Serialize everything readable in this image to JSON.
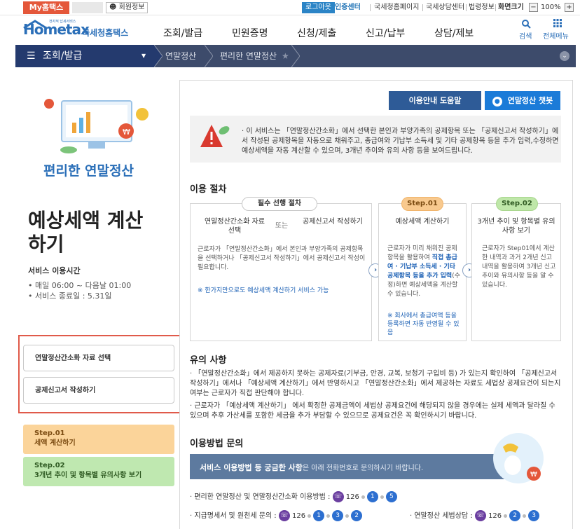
{
  "topbar": {
    "my_hometax": "My홈택스",
    "member_info": "회원정보",
    "logout": "로그아웃",
    "auth_center": "인증센터",
    "nts_home": "국세청홈페이지",
    "tax_counsel": "국세상담센터",
    "law_info": "법령정보",
    "screen_size": "화면크기",
    "zoom_minus": "−",
    "zoom_value": "100%",
    "zoom_plus": "+"
  },
  "header": {
    "logo_text": "Hometax",
    "logo_sub": "전자적 납세서비스",
    "logo_kr": "국세청홈택스",
    "gnb": [
      "조회/발급",
      "민원증명",
      "신청/제출",
      "신고/납부",
      "상담/제보"
    ],
    "search_label": "검색",
    "allmenu_label": "전체메뉴"
  },
  "breadcrumb": {
    "main": "조회/발급",
    "items": [
      "연말정산",
      "편리한 연말정산"
    ],
    "star": "★"
  },
  "left": {
    "service_title": "편리한 연말정산",
    "page_title": "예상세액 계산하기",
    "hours_heading": "서비스 이용시간",
    "hours_items": [
      "• 매일 06:00 ~ 다음날 01:00",
      "• 서비스 종료일 : 5.31일"
    ],
    "btn_simplified": "연말정산간소화 자료 선택",
    "btn_deduction": "공제신고서 작성하기",
    "step1_label": "Step.01",
    "step1_text": "세액 계산하기",
    "step2_label": "Step.02",
    "step2_text": "3개년 추이 및 항목별 유의사항 보기"
  },
  "main": {
    "btn_guide": "이용안내 도움말",
    "btn_chatbot": "연말정산 챗봇",
    "notice": "· 이 서비스는 「연말정산간소화」에서 선택한 본인과 부양가족의 공제항목 또는 「공제신고서 작성하기」에서 작성된 공제항목을 자동으로 채워주고, 총급여와 기납부 소득세 및 기타 공제항목 등을 추가 입력,수정하면 예상세액을 자동 계산할 수 있으며, 3개년 추이와 유의 사항 등을 보여드립니다.",
    "procedure_title": "이용 절차",
    "required_pill": "필수 선행 절차",
    "proc_left_a": "연말정산간소화 자료 선택",
    "proc_or": "또는",
    "proc_left_b": "공제신고서 작성하기",
    "proc_left_body": "근로자가 「연말정산간소화」에서 본인과 부양가족의 공제항목을 선택하거나 「공제신고서 작성하기」에서 공제신고서 작성이 필요합니다.",
    "proc_left_note": "※ 한가지만으로도 예상세액 계산하기 서비스 가능",
    "step1_pill": "Step.01",
    "step1_head": "예상세액 계산하기",
    "step1_body_a": "근로자가 미리 채워진 공제항목을 활용하여 ",
    "step1_body_blue": "직접 총급여 · 기납부 소득세 · 기타 공제항목 등을 추가 입력",
    "step1_body_b": "(수정)하면 예상세액을 계산할 수 있습니다.",
    "step1_note": "※ 회사에서 총급여액 등을 등록하면 자동 반영될 수 있음",
    "step2_pill": "Step.02",
    "step2_head": "3개년 추이 및 항목별 유의사항 보기",
    "step2_body": "근로자가 Step01에서 계산한 내역과 과거 2개년 신고내역을 활용하여 3개년 신고 추이와 유의사항 등을 알 수 있습니다.",
    "arrow": "›",
    "caution_title": "유의 사항",
    "caution_1": "· 「연말정산간소화」에서 제공하지 못하는 공제자료(기부금, 안경, 교복, 보청기 구입비 등) 가 있는지 확인하여 「공제신고서 작성하기」에서나 「예상세액 계산하기」에서 반영하시고 「연말정산간소화」에서 제공하는 자료도 세법상 공제요건이 되는지 여부는 근로자가 직접 판단해야 합니다.",
    "caution_2": "· 근로자가 「예상세액 계산하기」 에서 확정한 공제금액이 세법상 공제요건에 해당되지 않을 경우에는 실제 세액과 달라질 수 있으며 추후 가산세를 포함한 세금을 추가 부담할 수 있으므로 공제요건은 꼭 확인하시기 바랍니다.",
    "inquiry_title": "이용방법 문의",
    "banner_bold": "서비스 이용방법 등 궁금한 사항",
    "banner_rest": "은 아래 전화번호로 문의하시기 바랍니다.",
    "phone1_label": "· 편리한 연말정산 및 연말정산간소화 이용방법 :",
    "phone1_number": "126",
    "phone1_keys": [
      "1",
      "5"
    ],
    "phone2_label": "· 지급명세서 및 원천세 문의 :",
    "phone2_number": "126",
    "phone2_keys": [
      "1",
      "3",
      "2"
    ],
    "phone3_label": "· 연말정산 세법상담 :",
    "phone3_number": "126",
    "phone3_keys": [
      "2",
      "3"
    ]
  },
  "colors": {
    "brand_blue": "#2b6fb8",
    "nav_bar": "#3d4b6b",
    "my_hometax_red": "#e4573a",
    "highlight_red": "#e05a4a"
  }
}
